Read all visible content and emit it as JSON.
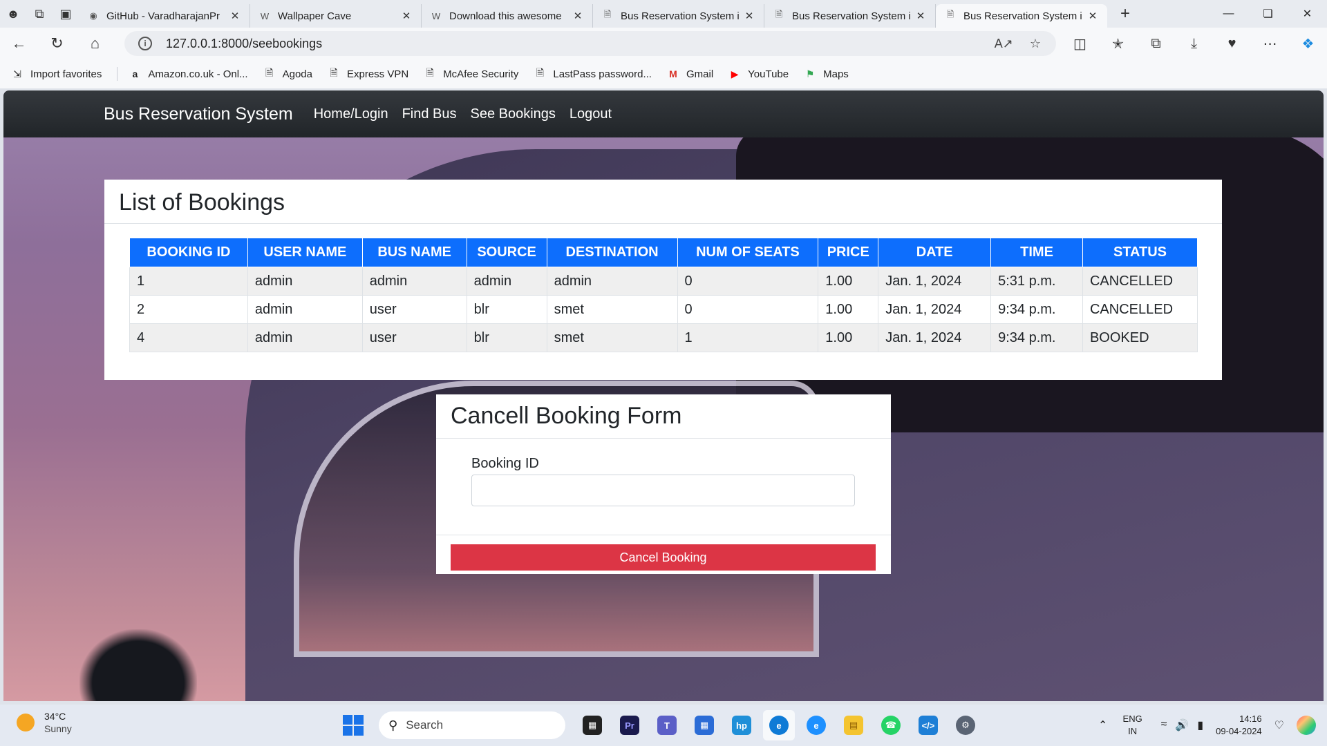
{
  "browser": {
    "tabs": [
      {
        "title": "GitHub - VaradharajanPr",
        "icon": "github-icon"
      },
      {
        "title": "Wallpaper Cave",
        "icon": "w-icon"
      },
      {
        "title": "Download this awesome",
        "icon": "w-icon"
      },
      {
        "title": "Bus Reservation System i",
        "icon": "page-icon"
      },
      {
        "title": "Bus Reservation System i",
        "icon": "page-icon"
      },
      {
        "title": "Bus Reservation System i",
        "icon": "page-icon"
      }
    ],
    "url": "127.0.0.1:8000/seebookings",
    "favorites": [
      "Import favorites",
      "Amazon.co.uk - Onl...",
      "Agoda",
      "Express VPN",
      "McAfee Security",
      "LastPass password...",
      "Gmail",
      "YouTube",
      "Maps"
    ]
  },
  "navbar": {
    "brand": "Bus Reservation System",
    "links": [
      "Home/Login",
      "Find Bus",
      "See Bookings",
      "Logout"
    ]
  },
  "bookings": {
    "title": "List of Bookings",
    "columns": [
      "BOOKING ID",
      "USER NAME",
      "BUS NAME",
      "SOURCE",
      "DESTINATION",
      "NUM OF SEATS",
      "PRICE",
      "DATE",
      "TIME",
      "STATUS"
    ],
    "rows": [
      [
        "1",
        "admin",
        "admin",
        "admin",
        "admin",
        "0",
        "1.00",
        "Jan. 1, 2024",
        "5:31 p.m.",
        "CANCELLED"
      ],
      [
        "2",
        "admin",
        "user",
        "blr",
        "smet",
        "0",
        "1.00",
        "Jan. 1, 2024",
        "9:34 p.m.",
        "CANCELLED"
      ],
      [
        "4",
        "admin",
        "user",
        "blr",
        "smet",
        "1",
        "1.00",
        "Jan. 1, 2024",
        "9:34 p.m.",
        "BOOKED"
      ]
    ]
  },
  "cancel_form": {
    "title": "Cancell Booking Form",
    "field_label": "Booking ID",
    "field_value": "",
    "button_label": "Cancel Booking",
    "button_color": "#dc3545"
  },
  "taskbar": {
    "weather_temp": "34°C",
    "weather_cond": "Sunny",
    "search_label": "Search",
    "lang_top": "ENG",
    "lang_bottom": "IN",
    "time": "14:16",
    "date": "09-04-2024"
  },
  "colors": {
    "navbar": "#212529",
    "table_header": "#0d6efd"
  }
}
